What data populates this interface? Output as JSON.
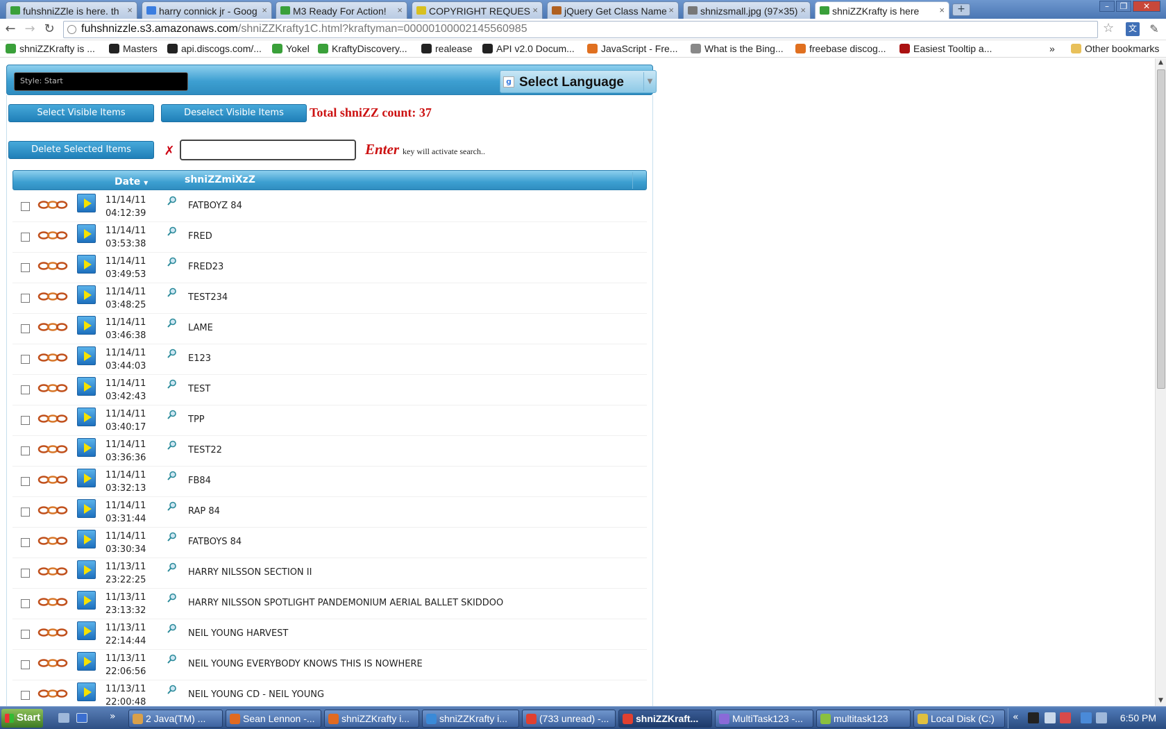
{
  "browser": {
    "tabs": [
      {
        "title": "fuhshniZZle is here. th",
        "color": "#3aa03a"
      },
      {
        "title": "harry connick jr - Goog",
        "color": "#3a7de0"
      },
      {
        "title": "M3 Ready For Action!",
        "color": "#3aa03a"
      },
      {
        "title": "COPYRIGHT REQUES",
        "color": "#d8c020"
      },
      {
        "title": "jQuery Get Class Name",
        "color": "#b06020"
      },
      {
        "title": "shnizsmall.jpg (97×35)",
        "color": "#777777"
      },
      {
        "title": "shniZZKrafty is here",
        "color": "#3aa03a",
        "active": true
      }
    ],
    "url_host": "fuhshnizzle.s3.amazonaws.com",
    "url_path": "/shniZZKrafty1C.html?kraftyman=00000100002145560985",
    "bookmarks": [
      {
        "label": "shniZZKrafty is ...",
        "color": "#3aa03a"
      },
      {
        "label": "Masters",
        "color": "#222222"
      },
      {
        "label": "api.discogs.com/...",
        "color": "#222222"
      },
      {
        "label": "Yokel",
        "color": "#3aa03a"
      },
      {
        "label": "KraftyDiscovery...",
        "color": "#3aa03a"
      },
      {
        "label": "realease",
        "color": "#222222"
      },
      {
        "label": "API v2.0 Docum...",
        "color": "#222222"
      },
      {
        "label": "JavaScript - Fre...",
        "color": "#e07020"
      },
      {
        "label": "What is the Bing...",
        "color": "#888888"
      },
      {
        "label": "freebase discog...",
        "color": "#e07020"
      },
      {
        "label": "Easiest Tooltip a...",
        "color": "#aa1111"
      }
    ],
    "other_bookmarks": "Other bookmarks"
  },
  "page": {
    "style_label": "Style: Start",
    "language_label": "Select Language",
    "select_visible": "Select Visible Items",
    "deselect_visible": "Deselect Visible Items",
    "total_label": "Total shniZZ count: 37",
    "delete_selected": "Delete Selected Items",
    "search_value": "",
    "hint_enter": "Enter",
    "hint_rest": "key will activate search..",
    "col_date": "Date",
    "col_name": "shniZZmiXzZ"
  },
  "rows": [
    {
      "date": "11/14/11",
      "time": "04:12:39",
      "name": "FATBOYZ 84"
    },
    {
      "date": "11/14/11",
      "time": "03:53:38",
      "name": "FRED"
    },
    {
      "date": "11/14/11",
      "time": "03:49:53",
      "name": "FRED23"
    },
    {
      "date": "11/14/11",
      "time": "03:48:25",
      "name": "TEST234"
    },
    {
      "date": "11/14/11",
      "time": "03:46:38",
      "name": "LAME"
    },
    {
      "date": "11/14/11",
      "time": "03:44:03",
      "name": "E123"
    },
    {
      "date": "11/14/11",
      "time": "03:42:43",
      "name": "TEST"
    },
    {
      "date": "11/14/11",
      "time": "03:40:17",
      "name": "TPP"
    },
    {
      "date": "11/14/11",
      "time": "03:36:36",
      "name": "TEST22"
    },
    {
      "date": "11/14/11",
      "time": "03:32:13",
      "name": "FB84"
    },
    {
      "date": "11/14/11",
      "time": "03:31:44",
      "name": "RAP 84"
    },
    {
      "date": "11/14/11",
      "time": "03:30:34",
      "name": "FATBOYS 84"
    },
    {
      "date": "11/13/11",
      "time": "23:22:25",
      "name": "HARRY NILSSON SECTION II"
    },
    {
      "date": "11/13/11",
      "time": "23:13:32",
      "name": "HARRY NILSSON SPOTLIGHT PANDEMONIUM AERIAL BALLET SKIDDOO"
    },
    {
      "date": "11/13/11",
      "time": "22:14:44",
      "name": "NEIL YOUNG HARVEST"
    },
    {
      "date": "11/13/11",
      "time": "22:06:56",
      "name": "NEIL YOUNG EVERYBODY KNOWS THIS IS NOWHERE"
    },
    {
      "date": "11/13/11",
      "time": "22:00:48",
      "name": "NEIL YOUNG CD - NEIL YOUNG"
    }
  ],
  "taskbar": {
    "start": "Start",
    "tasks": [
      {
        "label": "2 Java(TM) ...",
        "color": "#d9a04a"
      },
      {
        "label": "Sean Lennon -...",
        "color": "#e06a20"
      },
      {
        "label": "shniZZKrafty i...",
        "color": "#e06a20"
      },
      {
        "label": "shniZZKrafty i...",
        "color": "#3a8ad8"
      },
      {
        "label": "(733 unread) -...",
        "color": "#e04030"
      },
      {
        "label": "shniZZKraft...",
        "color": "#e04030",
        "active": true
      },
      {
        "label": "MultiTask123 -...",
        "color": "#8a6ad8"
      },
      {
        "label": "multitask123",
        "color": "#8ac040"
      },
      {
        "label": "Local Disk (C:)",
        "color": "#e0c040"
      }
    ],
    "clock": "6:50 PM"
  }
}
